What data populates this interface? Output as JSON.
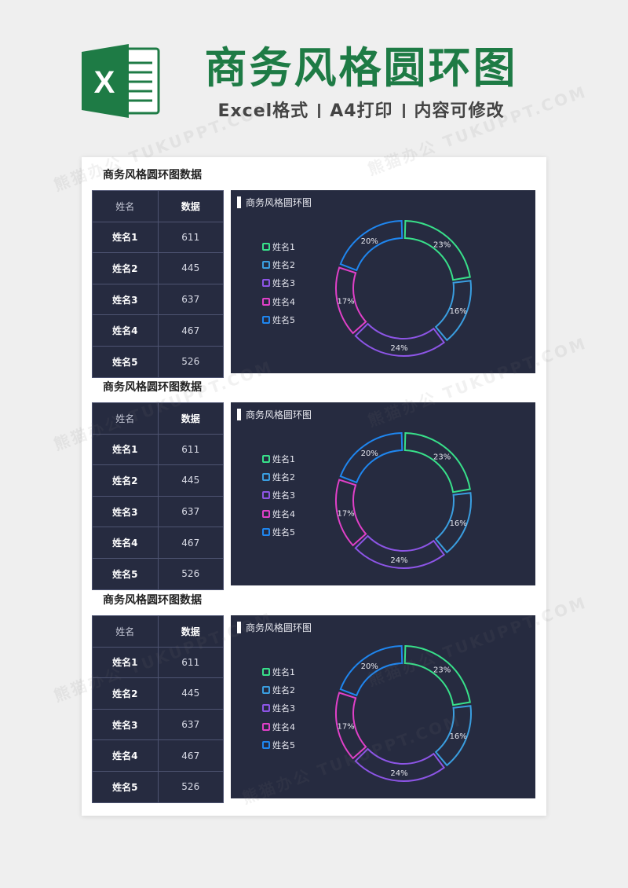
{
  "header": {
    "logo_letter": "X",
    "title": "商务风格圆环图",
    "subtitle_parts": [
      "Excel格式",
      "A4打印",
      "内容可修改"
    ]
  },
  "watermark": "熊猫办公 TUKUPPT.COM",
  "sections": [
    {
      "title": "商务风格圆环图数据",
      "table": {
        "headers": [
          "姓名",
          "数据"
        ],
        "rows": [
          [
            "姓名1",
            "611"
          ],
          [
            "姓名2",
            "445"
          ],
          [
            "姓名3",
            "637"
          ],
          [
            "姓名4",
            "467"
          ],
          [
            "姓名5",
            "526"
          ]
        ]
      },
      "chart_title": "商务风格圆环图"
    },
    {
      "title": "商务风格圆环图数据",
      "table": {
        "headers": [
          "姓名",
          "数据"
        ],
        "rows": [
          [
            "姓名1",
            "611"
          ],
          [
            "姓名2",
            "445"
          ],
          [
            "姓名3",
            "637"
          ],
          [
            "姓名4",
            "467"
          ],
          [
            "姓名5",
            "526"
          ]
        ]
      },
      "chart_title": "商务风格圆环图"
    },
    {
      "title": "商务风格圆环图数据",
      "table": {
        "headers": [
          "姓名",
          "数据"
        ],
        "rows": [
          [
            "姓名1",
            "611"
          ],
          [
            "姓名2",
            "445"
          ],
          [
            "姓名3",
            "637"
          ],
          [
            "姓名4",
            "467"
          ],
          [
            "姓名5",
            "526"
          ]
        ]
      },
      "chart_title": "商务风格圆环图"
    }
  ],
  "colors": {
    "brand": "#1e7b45",
    "panel": "#262b40",
    "series": [
      "#38e08a",
      "#3a9ee0",
      "#8d55e6",
      "#e040c8",
      "#1f86ef"
    ]
  },
  "chart_data": [
    {
      "type": "pie",
      "title": "商务风格圆环图",
      "legend": "left",
      "categories": [
        "姓名1",
        "姓名2",
        "姓名3",
        "姓名4",
        "姓名5"
      ],
      "values": [
        611,
        445,
        637,
        467,
        526
      ],
      "labels": [
        "23%",
        "16%",
        "24%",
        "17%",
        "20%"
      ]
    },
    {
      "type": "pie",
      "title": "商务风格圆环图",
      "legend": "left",
      "categories": [
        "姓名1",
        "姓名2",
        "姓名3",
        "姓名4",
        "姓名5"
      ],
      "values": [
        611,
        445,
        637,
        467,
        526
      ],
      "labels": [
        "23%",
        "16%",
        "24%",
        "17%",
        "20%"
      ]
    },
    {
      "type": "pie",
      "title": "商务风格圆环图",
      "legend": "left",
      "categories": [
        "姓名1",
        "姓名2",
        "姓名3",
        "姓名4",
        "姓名5"
      ],
      "values": [
        611,
        445,
        637,
        467,
        526
      ],
      "labels": [
        "23%",
        "16%",
        "24%",
        "17%",
        "20%"
      ]
    }
  ]
}
